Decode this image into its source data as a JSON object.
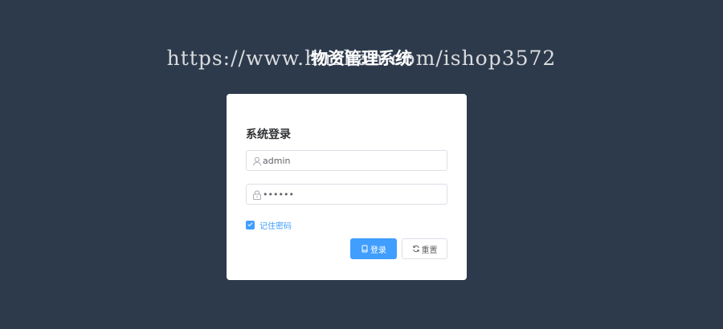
{
  "watermark": "https://www.huzhan.com/ishop3572",
  "app_title": "物资管理系统",
  "login_form": {
    "title": "系统登录",
    "username": {
      "value": "admin",
      "icon": "user-icon"
    },
    "password": {
      "value": "123456",
      "icon": "lock-icon"
    },
    "remember": {
      "label": "记住密码",
      "checked": true
    },
    "login_button": {
      "label": "登录",
      "icon": "login-icon"
    },
    "reset_button": {
      "label": "重置",
      "icon": "refresh-icon"
    }
  },
  "colors": {
    "background": "#2d3a4b",
    "primary": "#409eff",
    "border": "#dcdfe6"
  }
}
